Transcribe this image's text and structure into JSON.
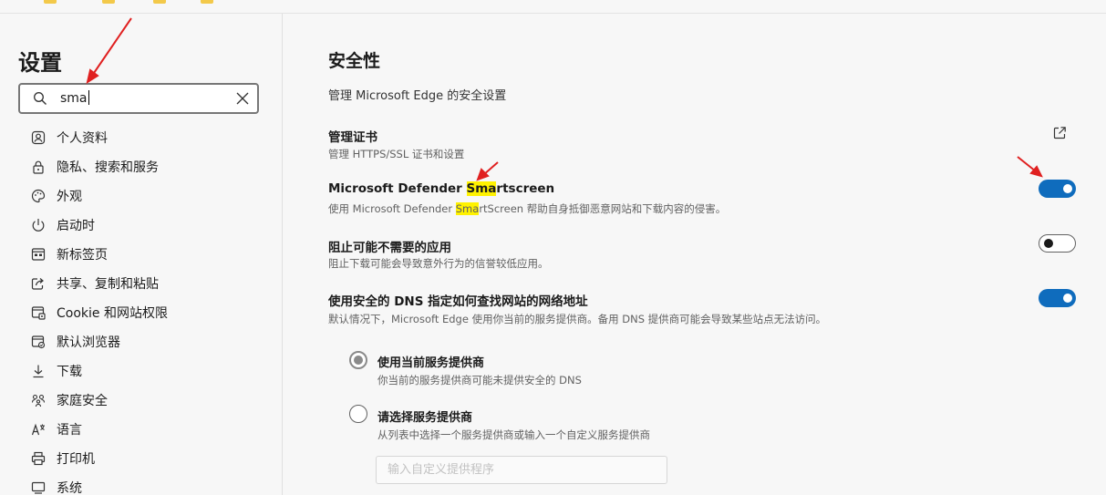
{
  "sidebar": {
    "title": "设置",
    "search": {
      "value": "sma",
      "icon": "search-icon",
      "clear_icon": "close-icon"
    },
    "items": [
      {
        "label": "个人资料",
        "icon": "profile-icon"
      },
      {
        "label": "隐私、搜索和服务",
        "icon": "lock-icon"
      },
      {
        "label": "外观",
        "icon": "palette-icon"
      },
      {
        "label": "启动时",
        "icon": "power-icon"
      },
      {
        "label": "新标签页",
        "icon": "new-tab-icon"
      },
      {
        "label": "共享、复制和粘贴",
        "icon": "share-icon"
      },
      {
        "label": "Cookie 和网站权限",
        "icon": "site-permissions-icon"
      },
      {
        "label": "默认浏览器",
        "icon": "browser-icon"
      },
      {
        "label": "下载",
        "icon": "download-icon"
      },
      {
        "label": "家庭安全",
        "icon": "family-icon"
      },
      {
        "label": "语言",
        "icon": "language-icon"
      },
      {
        "label": "打印机",
        "icon": "printer-icon"
      },
      {
        "label": "系统",
        "icon": "system-icon"
      }
    ]
  },
  "main": {
    "title": "安全性",
    "subtitle": "管理 Microsoft Edge 的安全设置",
    "certs": {
      "title": "管理证书",
      "desc": "管理 HTTPS/SSL 证书和设置",
      "icon": "external-link-icon"
    },
    "smartscreen": {
      "title_pre": "Microsoft Defender ",
      "title_hl": "Sma",
      "title_post": "rtscreen",
      "desc_pre": "使用 Microsoft Defender ",
      "desc_hl": "Sma",
      "desc_post": "rtScreen 帮助自身抵御恶意网站和下载内容的侵害。",
      "enabled": true
    },
    "pua": {
      "title": "阻止可能不需要的应用",
      "desc": "阻止下载可能会导致意外行为的信誉较低应用。",
      "enabled": false
    },
    "dns": {
      "title": "使用安全的 DNS 指定如何查找网站的网络地址",
      "desc": "默认情况下，Microsoft Edge 使用你当前的服务提供商。备用 DNS 提供商可能会导致某些站点无法访问。",
      "enabled": true,
      "options": [
        {
          "title": "使用当前服务提供商",
          "desc": "你当前的服务提供商可能未提供安全的 DNS",
          "checked": true
        },
        {
          "title": "请选择服务提供商",
          "desc": "从列表中选择一个服务提供商或输入一个自定义服务提供商",
          "checked": false
        }
      ],
      "custom_placeholder": "输入自定义提供程序"
    }
  },
  "colors": {
    "accent": "#0f6cbd",
    "highlight": "#fff200",
    "annotation": "#e02020"
  }
}
